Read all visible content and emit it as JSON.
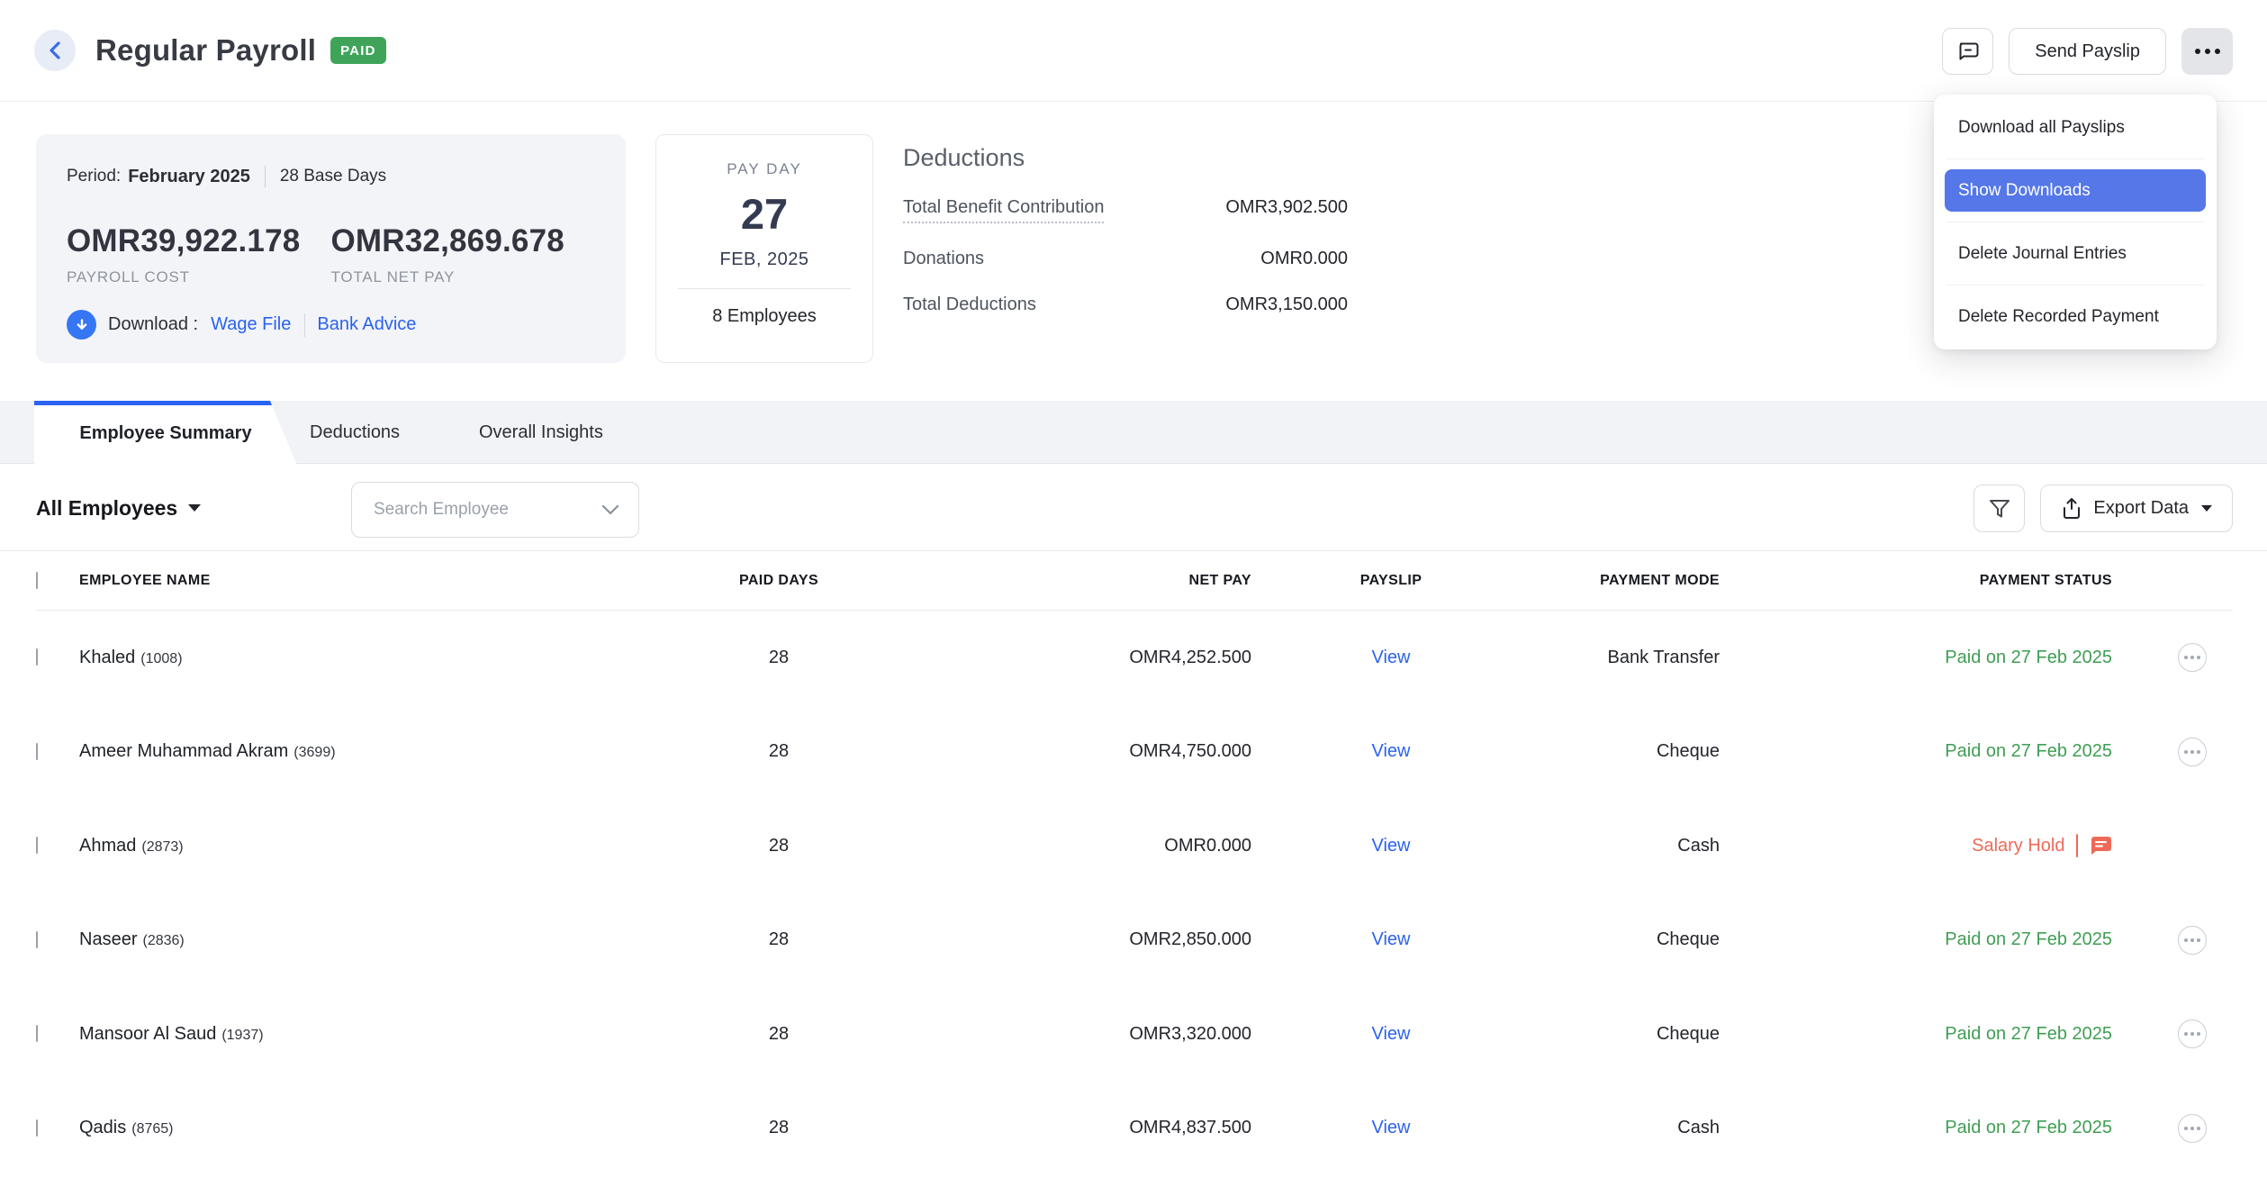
{
  "header": {
    "title": "Regular Payroll",
    "status_badge": "PAID",
    "send_payslip_label": "Send Payslip"
  },
  "menu": {
    "items": [
      {
        "label": "Download all Payslips"
      },
      {
        "label": "Show Downloads"
      },
      {
        "label": "Delete Journal Entries"
      },
      {
        "label": "Delete Recorded Payment"
      }
    ]
  },
  "summary": {
    "period_label": "Period:",
    "period_value": "February 2025",
    "base_days": "28 Base Days",
    "payroll_cost": "OMR39,922.178",
    "payroll_cost_label": "PAYROLL COST",
    "total_net_pay": "OMR32,869.678",
    "total_net_pay_label": "TOTAL NET PAY",
    "download_label": "Download :",
    "wage_file_label": "Wage File",
    "bank_advice_label": "Bank Advice"
  },
  "payday": {
    "label": "PAY DAY",
    "day": "27",
    "month_year": "FEB, 2025",
    "employees": "8 Employees"
  },
  "deductions": {
    "title": "Deductions",
    "rows": [
      {
        "label": "Total Benefit Contribution",
        "value": "OMR3,902.500"
      },
      {
        "label": "Donations",
        "value": "OMR0.000"
      },
      {
        "label": "Total Deductions",
        "value": "OMR3,150.000"
      }
    ]
  },
  "tabs": [
    {
      "label": "Employee Summary"
    },
    {
      "label": "Deductions"
    },
    {
      "label": "Overall Insights"
    }
  ],
  "toolbar": {
    "employee_filter_label": "All Employees",
    "search_placeholder": "Search Employee",
    "export_label": "Export Data"
  },
  "table": {
    "columns": [
      "EMPLOYEE NAME",
      "PAID DAYS",
      "NET PAY",
      "PAYSLIP",
      "PAYMENT MODE",
      "PAYMENT STATUS"
    ],
    "view_label": "View",
    "rows": [
      {
        "name": "Khaled",
        "id": "(1008)",
        "paid_days": "28",
        "net_pay": "OMR4,252.500",
        "payment_mode": "Bank Transfer",
        "status": "Paid on 27 Feb 2025",
        "status_type": "paid"
      },
      {
        "name": "Ameer Muhammad Akram",
        "id": "(3699)",
        "paid_days": "28",
        "net_pay": "OMR4,750.000",
        "payment_mode": "Cheque",
        "status": "Paid on 27 Feb 2025",
        "status_type": "paid"
      },
      {
        "name": "Ahmad",
        "id": "(2873)",
        "paid_days": "28",
        "net_pay": "OMR0.000",
        "payment_mode": "Cash",
        "status": "Salary Hold",
        "status_type": "hold"
      },
      {
        "name": "Naseer",
        "id": "(2836)",
        "paid_days": "28",
        "net_pay": "OMR2,850.000",
        "payment_mode": "Cheque",
        "status": "Paid on 27 Feb 2025",
        "status_type": "paid"
      },
      {
        "name": "Mansoor Al Saud",
        "id": "(1937)",
        "paid_days": "28",
        "net_pay": "OMR3,320.000",
        "payment_mode": "Cheque",
        "status": "Paid on 27 Feb 2025",
        "status_type": "paid"
      },
      {
        "name": "Qadis",
        "id": "(8765)",
        "paid_days": "28",
        "net_pay": "OMR4,837.500",
        "payment_mode": "Cash",
        "status": "Paid on 27 Feb 2025",
        "status_type": "paid"
      }
    ]
  },
  "colors": {
    "accent_blue": "#2a62f0",
    "menu_highlight_blue": "#5577e8",
    "tab_bar_blue": "#2b63f2",
    "badge_green": "#3fa45a",
    "status_green": "#3f9e53",
    "status_red": "#ee6a58"
  }
}
